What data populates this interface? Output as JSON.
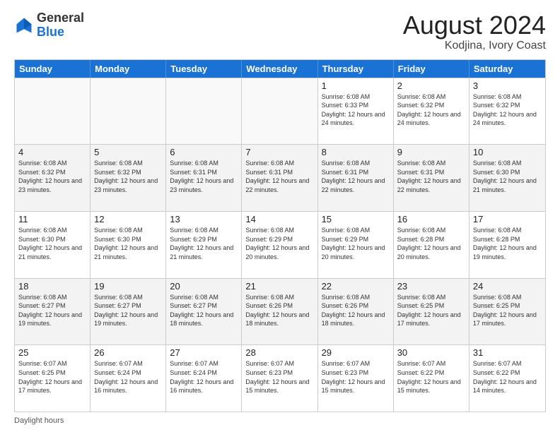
{
  "header": {
    "logo_line1": "General",
    "logo_line2": "Blue",
    "month": "August 2024",
    "location": "Kodjina, Ivory Coast"
  },
  "days_of_week": [
    "Sunday",
    "Monday",
    "Tuesday",
    "Wednesday",
    "Thursday",
    "Friday",
    "Saturday"
  ],
  "weeks": [
    [
      {
        "day": "",
        "empty": true
      },
      {
        "day": "",
        "empty": true
      },
      {
        "day": "",
        "empty": true
      },
      {
        "day": "",
        "empty": true
      },
      {
        "day": "1",
        "sunrise": "6:08 AM",
        "sunset": "6:33 PM",
        "daylight": "12 hours and 24 minutes."
      },
      {
        "day": "2",
        "sunrise": "6:08 AM",
        "sunset": "6:32 PM",
        "daylight": "12 hours and 24 minutes."
      },
      {
        "day": "3",
        "sunrise": "6:08 AM",
        "sunset": "6:32 PM",
        "daylight": "12 hours and 24 minutes."
      }
    ],
    [
      {
        "day": "4",
        "sunrise": "6:08 AM",
        "sunset": "6:32 PM",
        "daylight": "12 hours and 23 minutes."
      },
      {
        "day": "5",
        "sunrise": "6:08 AM",
        "sunset": "6:32 PM",
        "daylight": "12 hours and 23 minutes."
      },
      {
        "day": "6",
        "sunrise": "6:08 AM",
        "sunset": "6:31 PM",
        "daylight": "12 hours and 23 minutes."
      },
      {
        "day": "7",
        "sunrise": "6:08 AM",
        "sunset": "6:31 PM",
        "daylight": "12 hours and 22 minutes."
      },
      {
        "day": "8",
        "sunrise": "6:08 AM",
        "sunset": "6:31 PM",
        "daylight": "12 hours and 22 minutes."
      },
      {
        "day": "9",
        "sunrise": "6:08 AM",
        "sunset": "6:31 PM",
        "daylight": "12 hours and 22 minutes."
      },
      {
        "day": "10",
        "sunrise": "6:08 AM",
        "sunset": "6:30 PM",
        "daylight": "12 hours and 21 minutes."
      }
    ],
    [
      {
        "day": "11",
        "sunrise": "6:08 AM",
        "sunset": "6:30 PM",
        "daylight": "12 hours and 21 minutes."
      },
      {
        "day": "12",
        "sunrise": "6:08 AM",
        "sunset": "6:30 PM",
        "daylight": "12 hours and 21 minutes."
      },
      {
        "day": "13",
        "sunrise": "6:08 AM",
        "sunset": "6:29 PM",
        "daylight": "12 hours and 21 minutes."
      },
      {
        "day": "14",
        "sunrise": "6:08 AM",
        "sunset": "6:29 PM",
        "daylight": "12 hours and 20 minutes."
      },
      {
        "day": "15",
        "sunrise": "6:08 AM",
        "sunset": "6:29 PM",
        "daylight": "12 hours and 20 minutes."
      },
      {
        "day": "16",
        "sunrise": "6:08 AM",
        "sunset": "6:28 PM",
        "daylight": "12 hours and 20 minutes."
      },
      {
        "day": "17",
        "sunrise": "6:08 AM",
        "sunset": "6:28 PM",
        "daylight": "12 hours and 19 minutes."
      }
    ],
    [
      {
        "day": "18",
        "sunrise": "6:08 AM",
        "sunset": "6:27 PM",
        "daylight": "12 hours and 19 minutes."
      },
      {
        "day": "19",
        "sunrise": "6:08 AM",
        "sunset": "6:27 PM",
        "daylight": "12 hours and 19 minutes."
      },
      {
        "day": "20",
        "sunrise": "6:08 AM",
        "sunset": "6:27 PM",
        "daylight": "12 hours and 18 minutes."
      },
      {
        "day": "21",
        "sunrise": "6:08 AM",
        "sunset": "6:26 PM",
        "daylight": "12 hours and 18 minutes."
      },
      {
        "day": "22",
        "sunrise": "6:08 AM",
        "sunset": "6:26 PM",
        "daylight": "12 hours and 18 minutes."
      },
      {
        "day": "23",
        "sunrise": "6:08 AM",
        "sunset": "6:25 PM",
        "daylight": "12 hours and 17 minutes."
      },
      {
        "day": "24",
        "sunrise": "6:08 AM",
        "sunset": "6:25 PM",
        "daylight": "12 hours and 17 minutes."
      }
    ],
    [
      {
        "day": "25",
        "sunrise": "6:07 AM",
        "sunset": "6:25 PM",
        "daylight": "12 hours and 17 minutes."
      },
      {
        "day": "26",
        "sunrise": "6:07 AM",
        "sunset": "6:24 PM",
        "daylight": "12 hours and 16 minutes."
      },
      {
        "day": "27",
        "sunrise": "6:07 AM",
        "sunset": "6:24 PM",
        "daylight": "12 hours and 16 minutes."
      },
      {
        "day": "28",
        "sunrise": "6:07 AM",
        "sunset": "6:23 PM",
        "daylight": "12 hours and 15 minutes."
      },
      {
        "day": "29",
        "sunrise": "6:07 AM",
        "sunset": "6:23 PM",
        "daylight": "12 hours and 15 minutes."
      },
      {
        "day": "30",
        "sunrise": "6:07 AM",
        "sunset": "6:22 PM",
        "daylight": "12 hours and 15 minutes."
      },
      {
        "day": "31",
        "sunrise": "6:07 AM",
        "sunset": "6:22 PM",
        "daylight": "12 hours and 14 minutes."
      }
    ]
  ],
  "footer": {
    "daylight_label": "Daylight hours"
  }
}
